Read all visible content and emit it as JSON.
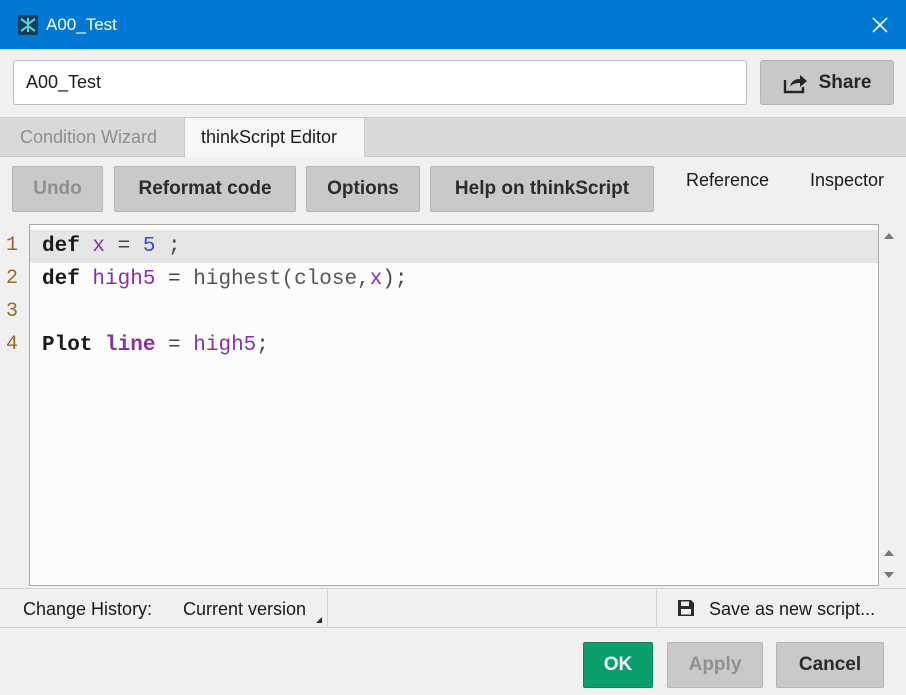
{
  "window": {
    "title": "A00_Test",
    "title_bar_color": "#0078d4"
  },
  "study_name": {
    "value": "A00_Test"
  },
  "share_label": "Share",
  "tabs": [
    {
      "label": "Condition Wizard",
      "active": false
    },
    {
      "label": "thinkScript Editor",
      "active": true
    }
  ],
  "toolbar": {
    "undo": "Undo",
    "reformat": "Reformat code",
    "options": "Options",
    "help": "Help on thinkScript",
    "reference": "Reference",
    "inspector": "Inspector"
  },
  "editor": {
    "line_numbers": [
      "1",
      "2",
      "3",
      "4"
    ],
    "lines": [
      {
        "kw": "def",
        "name": "x",
        "op": " = ",
        "num": "5",
        "tail": " ;"
      },
      {
        "kw": "def",
        "name": "high5",
        "op": " = ",
        "fn": "highest(close,",
        "arg": "x",
        "tail": ");"
      },
      {},
      {
        "kw": "Plot",
        "name": "line",
        "op": " = ",
        "ref": "high5",
        "tail": ";"
      }
    ]
  },
  "status": {
    "history_label": "Change History:",
    "version": "Current version",
    "save_new": "Save as new script..."
  },
  "footer": {
    "ok": "OK",
    "apply": "Apply",
    "cancel": "Cancel",
    "ok_color": "#089e6e"
  }
}
